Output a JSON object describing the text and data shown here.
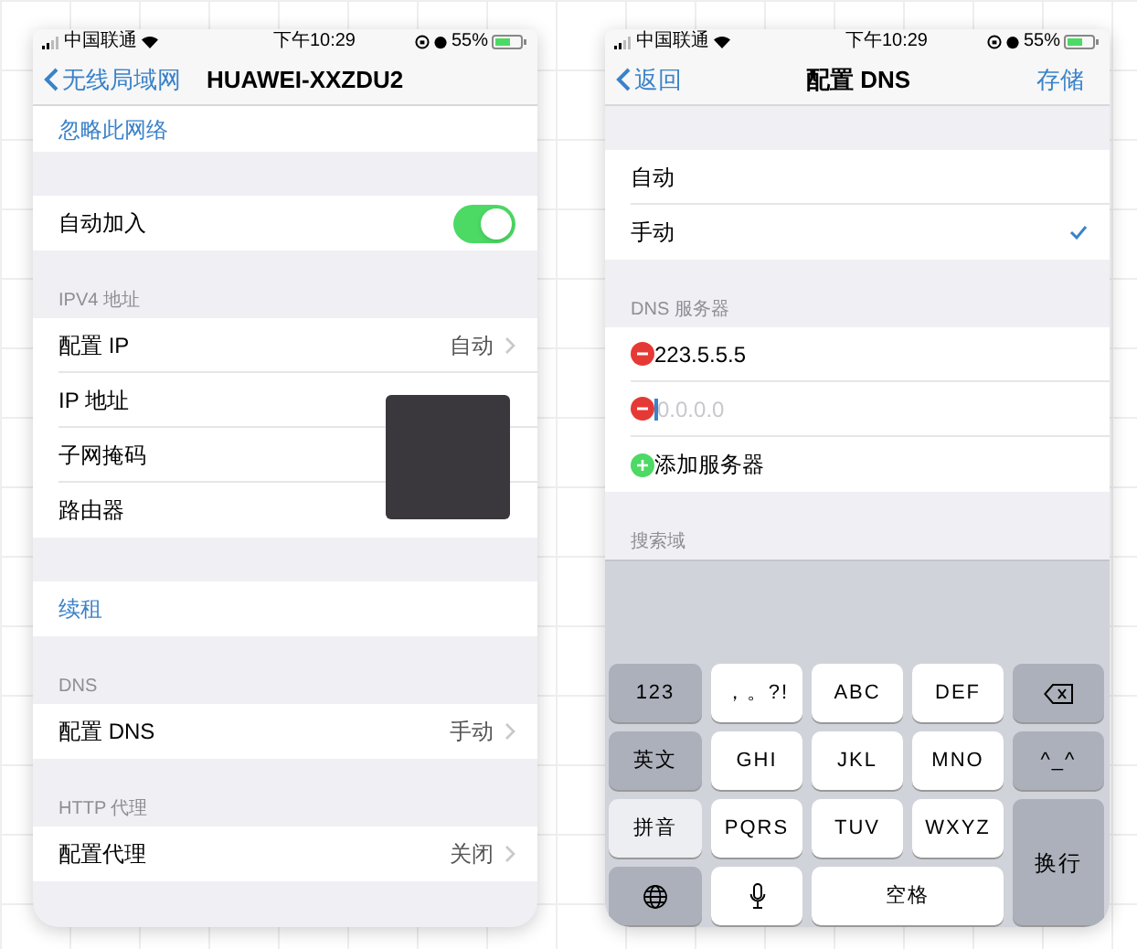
{
  "screens": [
    {
      "status_bar": {
        "carrier": "中国联通",
        "time": "下午10:29",
        "battery": "55%"
      },
      "nav": {
        "back": "无线局域网",
        "title": "HUAWEI-XXZDU2"
      },
      "sections": [
        {
          "partially_scrolled": true,
          "rows": [
            {
              "kind": "link",
              "label": "忽略此网络"
            }
          ]
        },
        {
          "rows": [
            {
              "kind": "toggle",
              "label": "自动加入",
              "on": true
            }
          ]
        },
        {
          "header": "IPV4 地址",
          "redacted": true,
          "rows": [
            {
              "kind": "value",
              "label": "配置 IP",
              "value": "自动"
            },
            {
              "kind": "plain",
              "label": "IP 地址"
            },
            {
              "kind": "plain",
              "label": "子网掩码"
            },
            {
              "kind": "plain",
              "label": "路由器"
            }
          ]
        },
        {
          "rows": [
            {
              "kind": "link",
              "label": "续租"
            }
          ]
        },
        {
          "header": "DNS",
          "rows": [
            {
              "kind": "value",
              "label": "配置 DNS",
              "value": "手动"
            }
          ]
        },
        {
          "header": "HTTP 代理",
          "rows": [
            {
              "kind": "value",
              "label": "配置代理",
              "value": "关闭"
            }
          ]
        }
      ]
    },
    {
      "status_bar": {
        "carrier": "中国联通",
        "time": "下午10:29",
        "battery": "55%"
      },
      "nav": {
        "back": "返回",
        "title": "配置 DNS",
        "action": "存储"
      },
      "sections": [
        {
          "rows": [
            {
              "kind": "option",
              "label": "自动",
              "selected": false
            },
            {
              "kind": "option",
              "label": "手动",
              "selected": true
            }
          ]
        },
        {
          "header": "DNS 服务器",
          "rows": [
            {
              "kind": "server",
              "value": "223.5.5.5"
            },
            {
              "kind": "server_input",
              "placeholder": "0.0.0.0"
            },
            {
              "kind": "add",
              "label": "添加服务器"
            }
          ]
        },
        {
          "header": "搜索域"
        }
      ],
      "keyboard": [
        {
          "kind": "function",
          "label": "123"
        },
        {
          "kind": "char",
          "label": "，。?!"
        },
        {
          "kind": "char",
          "label": "ABC"
        },
        {
          "kind": "char",
          "label": "DEF"
        },
        {
          "kind": "delete"
        },
        {
          "kind": "function",
          "label": "英文"
        },
        {
          "kind": "char",
          "label": "GHI"
        },
        {
          "kind": "char",
          "label": "JKL"
        },
        {
          "kind": "char",
          "label": "MNO"
        },
        {
          "kind": "function",
          "label": "^_^"
        },
        {
          "kind": "mode",
          "label": "拼音"
        },
        {
          "kind": "char",
          "label": "PQRS"
        },
        {
          "kind": "char",
          "label": "TUV"
        },
        {
          "kind": "char",
          "label": "WXYZ"
        },
        {
          "kind": "return",
          "label": "换行"
        },
        {
          "kind": "globe"
        },
        {
          "kind": "mic"
        },
        {
          "kind": "space",
          "label": "空格"
        }
      ]
    }
  ]
}
